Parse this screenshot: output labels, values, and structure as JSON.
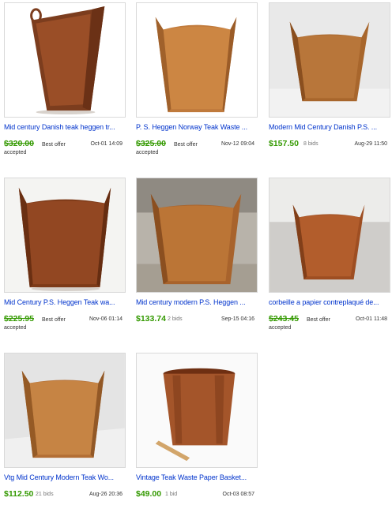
{
  "listings": [
    {
      "title": "Mid century Danish teak heggen tr...",
      "price": "$320.00",
      "status_line1": "Best offer",
      "status_line2": "accepted",
      "date": "Oct-01 14:09"
    },
    {
      "title": "P. S. Heggen Norway Teak Waste ...",
      "price": "$325.00",
      "status_line1": "Best offer",
      "status_line2": "accepted",
      "date": "Nov-12 09:04"
    },
    {
      "title": "Modern Mid Century Danish P.S. ...",
      "price": "$157.50",
      "bids": "8 bids",
      "date": "Aug-29 11:50"
    },
    {
      "title": "Mid Century P.S. Heggen Teak wa...",
      "price": "$225.95",
      "status_line1": "Best offer",
      "status_line2": "accepted",
      "date": "Nov-06 01:14"
    },
    {
      "title": "Mid century modern P.S. Heggen ...",
      "price": "$133.74",
      "bids": "2 bids",
      "date": "Sep-15 04:16"
    },
    {
      "title": "corbeille a papier contreplaqué de...",
      "price": "$243.45",
      "status_line1": "Best offer",
      "status_line2": "accepted",
      "date": "Oct-01 11:48"
    },
    {
      "title": "Vtg Mid Century Modern Teak Wo...",
      "price": "$112.50",
      "bids": "21 bids",
      "date": "Aug-26 20:36"
    },
    {
      "title": "Vintage Teak Waste Paper Basket...",
      "price": "$49.00",
      "bids": "1 bid",
      "date": "Oct-03 08:57"
    }
  ],
  "colors": {
    "link": "#0033cc",
    "price": "#339900",
    "teak": "#a0582a"
  }
}
